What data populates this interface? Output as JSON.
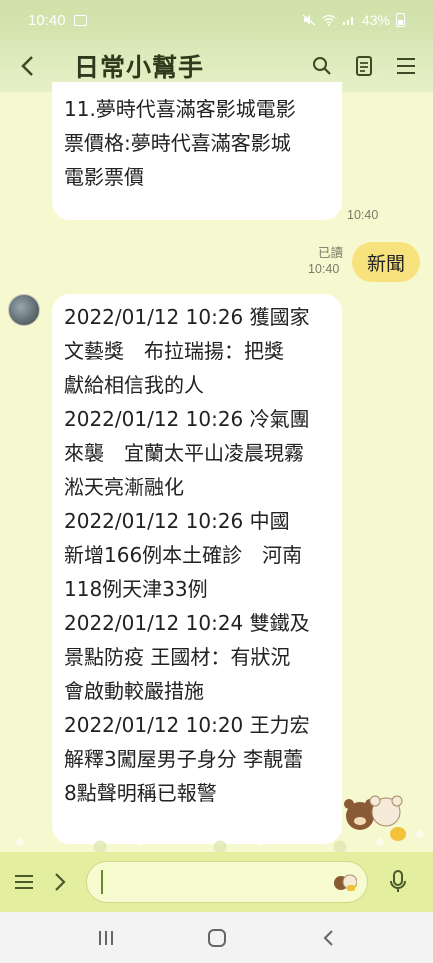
{
  "status_bar": {
    "time": "10:40",
    "battery": "43%"
  },
  "header": {
    "title": "日常小幫手"
  },
  "messages": [
    {
      "lines": [
        "11.夢時代喜滿客影城電影",
        "票價格:夢時代喜滿客影城",
        "電影票價"
      ],
      "time": "10:40"
    },
    {
      "read_label": "已讀",
      "time": "10:40",
      "text": "新聞"
    },
    {
      "lines": [
        "2022/01/12 10:26 獲國家",
        "文藝獎　布拉瑞揚：把獎",
        "獻給相信我的人",
        "2022/01/12 10:26 冷氣團",
        "來襲　宜蘭太平山凌晨現霧",
        "淞天亮漸融化",
        "2022/01/12 10:26 中國",
        "新增166例本土確診　河南",
        "118例天津33例",
        "2022/01/12 10:24 雙鐵及",
        "景點防疫 王國材：有狀況",
        "會啟動較嚴措施",
        "2022/01/12 10:20 王力宏",
        "解釋3闖屋男子身分 李靚蕾",
        "8點聲明稱已報警"
      ]
    }
  ],
  "colors": {
    "chat_bg": "#f6f8cf",
    "sent_bubble": "#f8e27e",
    "input_bar": "#e3ee9f"
  }
}
